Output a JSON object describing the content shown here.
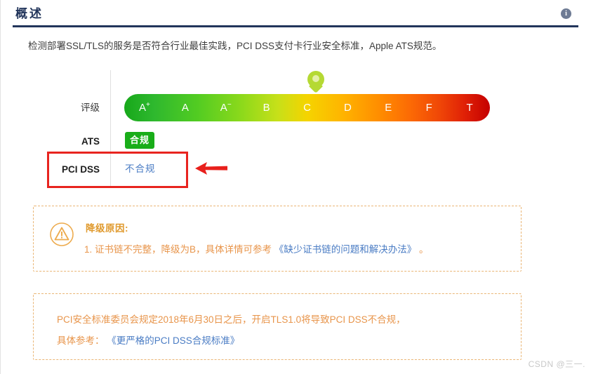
{
  "header": {
    "title": "概述",
    "info_icon": "info-circle-icon"
  },
  "description": "检测部署SSL/TLS的服务是否符合行业最佳实践，PCI DSS支付卡行业安全标准，Apple ATS规范。",
  "rating": {
    "label": "评级",
    "grades": [
      "A+",
      "A",
      "A-",
      "B",
      "C",
      "D",
      "E",
      "F",
      "T"
    ],
    "current_grade": "B",
    "marker_icon": "map-pin-marker-icon",
    "gradient_start": "#17a81a",
    "gradient_end": "#c40000"
  },
  "ats": {
    "label": "ATS",
    "value": "合规",
    "badge_color": "#19ad19"
  },
  "pci": {
    "label": "PCI DSS",
    "value": "不合规",
    "value_color": "#4a7cc4",
    "highlight_color": "#e8241f",
    "arrow_icon": "left-arrow-annotation-icon"
  },
  "warning_box": {
    "icon": "warning-triangle-icon",
    "title": "降级原因:",
    "item_prefix": "1. 证书链不完整，降级为B，具体详情可参考",
    "item_link": "《缺少证书链的问题和解决办法》",
    "item_suffix": "。",
    "accent_color": "#e09a2e"
  },
  "pci_note_box": {
    "line1": "PCI安全标准委员会规定2018年6月30日之后，开启TLS1.0将导致PCI DSS不合规，",
    "line2_prefix": "具体参考：",
    "line2_link": "《更严格的PCI DSS合规标准》"
  },
  "watermark": "CSDN @三一."
}
